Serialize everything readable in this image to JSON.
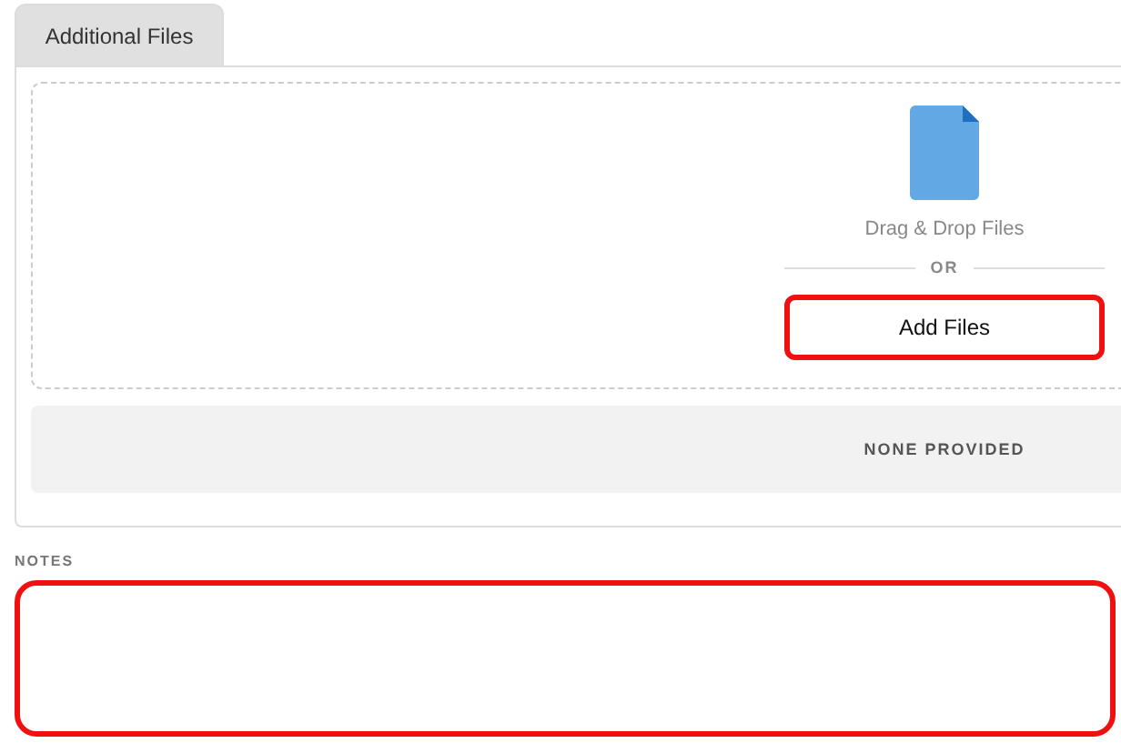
{
  "tabs": [
    {
      "label": "Additional Files",
      "selected": true
    }
  ],
  "upload": {
    "hint": "Drag & Drop Files",
    "separator": "OR",
    "button": {
      "label": "Add Files",
      "highlighted": true
    }
  },
  "files_status": "NONE PROVIDED",
  "notes": {
    "label": "NOTES",
    "highlighted": true
  }
}
